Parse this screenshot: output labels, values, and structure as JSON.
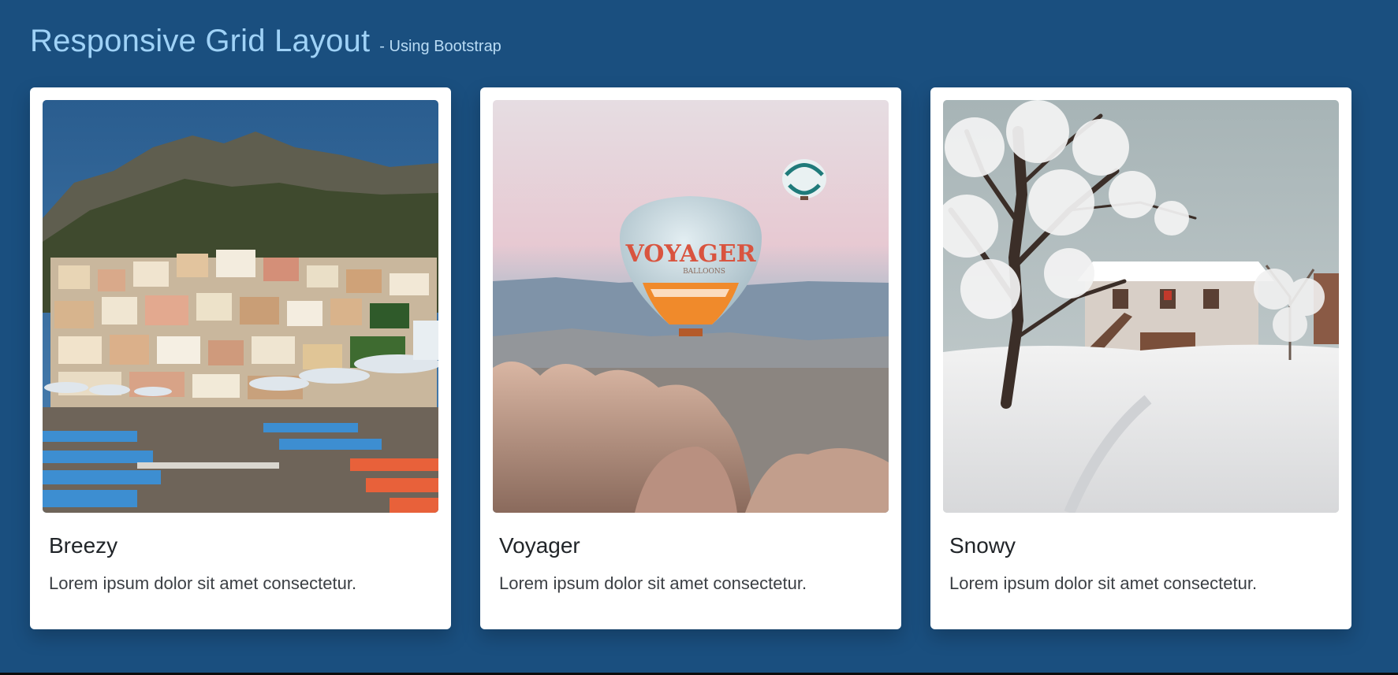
{
  "header": {
    "title": "Responsive Grid Layout",
    "subtitle": "- Using Bootstrap"
  },
  "cards": [
    {
      "title": "Breezy",
      "text": "Lorem ipsum dolor sit amet consectetur.",
      "image": "beach-town-photo"
    },
    {
      "title": "Voyager",
      "text": "Lorem ipsum dolor sit amet consectetur.",
      "image": "hot-air-balloon-photo",
      "balloon_text": "VOYAGER",
      "balloon_subtext": "BALLOONS"
    },
    {
      "title": "Snowy",
      "text": "Lorem ipsum dolor sit amet consectetur.",
      "image": "snowy-house-photo"
    }
  ],
  "colors": {
    "background": "#1a4f7f",
    "title": "#9fd2f7",
    "card": "#ffffff"
  }
}
